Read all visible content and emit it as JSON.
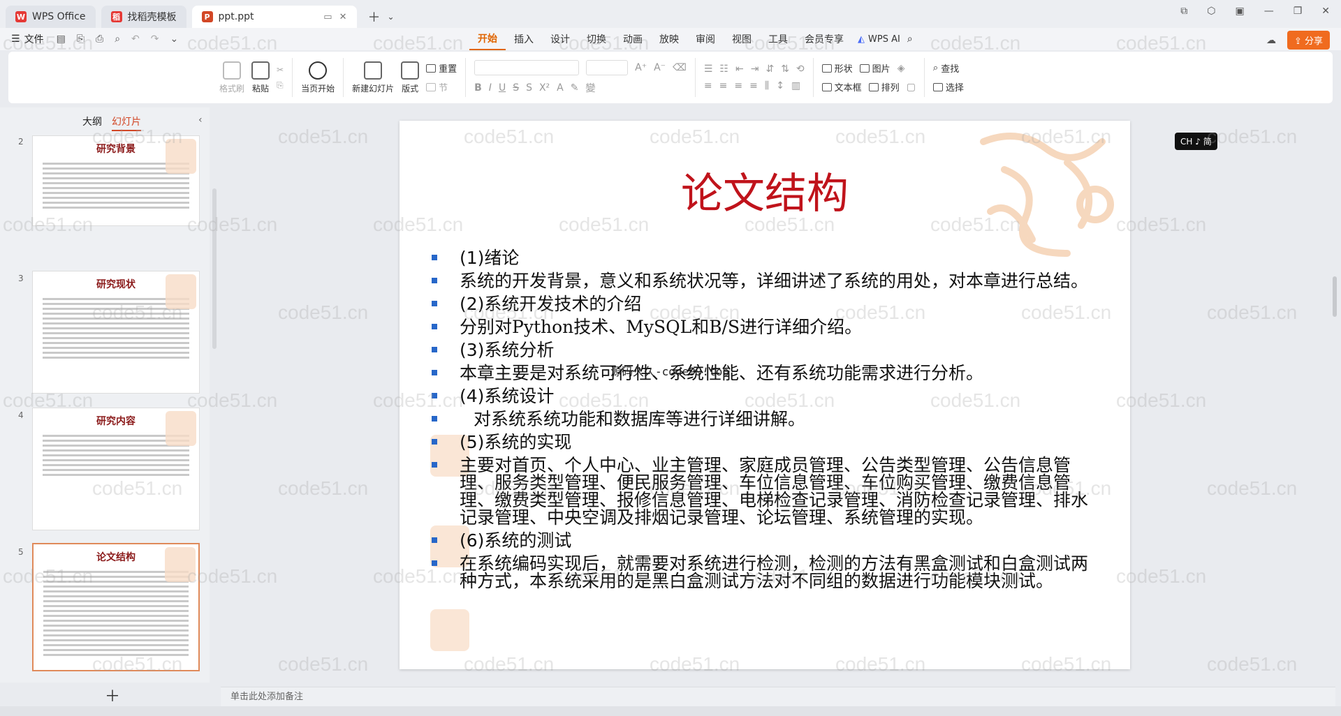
{
  "tabs": [
    {
      "label": "WPS Office",
      "icon": "wps-logo-icon"
    },
    {
      "label": "找稻壳模板",
      "icon": "template-icon"
    },
    {
      "label": "ppt.ppt",
      "icon": "ppt-file-icon"
    }
  ],
  "menu": {
    "file": "文件",
    "ribbon_tabs": [
      "开始",
      "插入",
      "设计",
      "切换",
      "动画",
      "放映",
      "审阅",
      "视图",
      "工具",
      "会员专享"
    ],
    "active_tab": "开始",
    "wps_ai": "WPS AI",
    "share": "分享"
  },
  "ribbon": {
    "format_painter": "格式刷",
    "paste": "粘贴",
    "start_show": "当页开始",
    "new_slide": "新建幻灯片",
    "layout": "版式",
    "reset": "重置",
    "section": "节",
    "shape": "形状",
    "picture": "图片",
    "textbox": "文本框",
    "arrange": "排列",
    "find": "查找",
    "select": "选择"
  },
  "panel": {
    "tab_outline": "大纲",
    "tab_slides": "幻灯片",
    "thumbnails": [
      {
        "num": "2",
        "title": "研究背景"
      },
      {
        "num": "3",
        "title": "研究现状"
      },
      {
        "num": "4",
        "title": "研究内容"
      },
      {
        "num": "5",
        "title": "论文结构"
      }
    ]
  },
  "slide": {
    "title": "论文结构",
    "overlay": "源码久久-code99.top",
    "bullets": [
      {
        "text": " (1)绪论",
        "type": "heading"
      },
      {
        "text": "系统的开发背景，意义和系统状况等，详细讲述了系统的用处，对本章进行总结。",
        "type": "body"
      },
      {
        "text": "(2)系统开发技术的介绍",
        "type": "heading"
      },
      {
        "text": "分别对Python技术、MySQL和B/S进行详细介绍。",
        "type": "body"
      },
      {
        "text": "(3)系统分析",
        "type": "heading"
      },
      {
        "text": "本章主要是对系统可行性、系统性能、还有系统功能需求进行分析。",
        "type": "body"
      },
      {
        "text": "(4)系统设计",
        "type": "heading"
      },
      {
        "text": "对系统系统功能和数据库等进行详细讲解。",
        "type": "indent"
      },
      {
        "text": "(5)系统的实现",
        "type": "heading"
      },
      {
        "text": "主要对首页、个人中心、业主管理、家庭成员管理、公告类型管理、公告信息管理、服务类型管理、便民服务管理、车位信息管理、车位购买管理、缴费信息管理、缴费类型管理、报修信息管理、电梯检查记录管理、消防检查记录管理、排水记录管理、中央空调及排烟记录管理、论坛管理、系统管理的实现。",
        "type": "body"
      },
      {
        "text": "(6)系统的测试",
        "type": "heading"
      },
      {
        "text": "在系统编码实现后，就需要对系统进行检测，检测的方法有黑盒测试和白盒测试两种方式，本系统采用的是黑白盒测试方法对不同组的数据进行功能模块测试。",
        "type": "body"
      }
    ]
  },
  "ime": "CH ♪ 简",
  "notes_placeholder": "单击此处添加备注",
  "watermark": "code51.cn"
}
